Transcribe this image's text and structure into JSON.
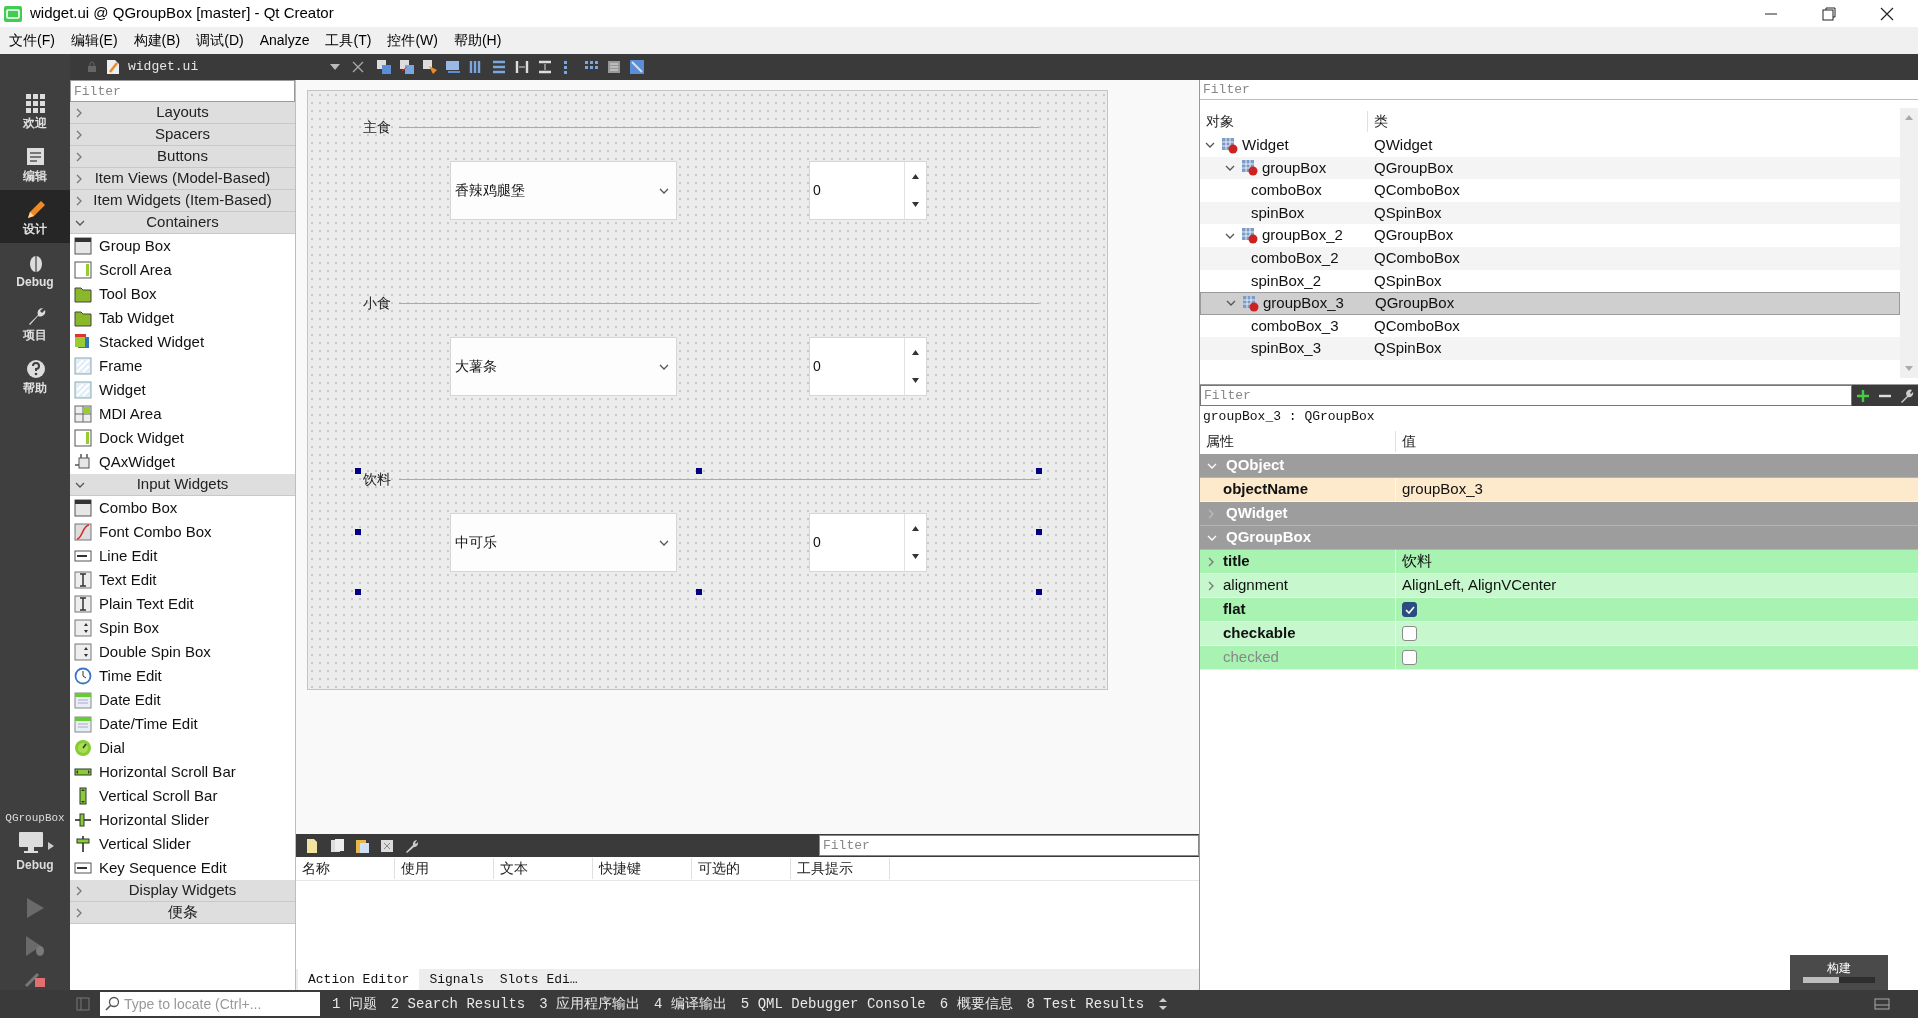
{
  "window": {
    "title": "widget.ui @ QGroupBox [master] - Qt Creator"
  },
  "menu": [
    "文件(F)",
    "编辑(E)",
    "构建(B)",
    "调试(D)",
    "Analyze",
    "工具(T)",
    "控件(W)",
    "帮助(H)"
  ],
  "toolbar": {
    "file": "widget.ui"
  },
  "modes": [
    {
      "label": "欢迎",
      "selected": false
    },
    {
      "label": "编辑",
      "selected": false
    },
    {
      "label": "设计",
      "selected": true
    },
    {
      "label": "Debug",
      "selected": false
    },
    {
      "label": "项目",
      "selected": false
    },
    {
      "label": "帮助",
      "selected": false
    }
  ],
  "kit": {
    "project": "QGroupBox",
    "mode": "Debug"
  },
  "widget_box": {
    "placeholder": "Filter",
    "categories": [
      {
        "label": "Layouts",
        "expanded": false
      },
      {
        "label": "Spacers",
        "expanded": false
      },
      {
        "label": "Buttons",
        "expanded": false
      },
      {
        "label": "Item Views (Model-Based)",
        "expanded": false
      },
      {
        "label": "Item Widgets (Item-Based)",
        "expanded": false
      },
      {
        "label": "Containers",
        "expanded": true,
        "items": [
          "Group Box",
          "Scroll Area",
          "Tool Box",
          "Tab Widget",
          "Stacked Widget",
          "Frame",
          "Widget",
          "MDI Area",
          "Dock Widget",
          "QAxWidget"
        ]
      },
      {
        "label": "Input Widgets",
        "expanded": true,
        "items": [
          "Combo Box",
          "Font Combo Box",
          "Line Edit",
          "Text Edit",
          "Plain Text Edit",
          "Spin Box",
          "Double Spin Box",
          "Time Edit",
          "Date Edit",
          "Date/Time Edit",
          "Dial",
          "Horizontal Scroll Bar",
          "Vertical Scroll Bar",
          "Horizontal Slider",
          "Vertical Slider",
          "Key Sequence Edit"
        ]
      },
      {
        "label": "Display Widgets",
        "expanded": false
      },
      {
        "label": "便条",
        "expanded": false
      }
    ]
  },
  "form": {
    "group_boxes": [
      {
        "title": "主食",
        "combo": "香辣鸡腿堡",
        "spin": "0",
        "selected": false
      },
      {
        "title": "小食",
        "combo": "大薯条",
        "spin": "0",
        "selected": false
      },
      {
        "title": "饮料",
        "combo": "中可乐",
        "spin": "0",
        "selected": true
      }
    ]
  },
  "action_editor": {
    "placeholder": "Filter",
    "columns": [
      "名称",
      "使用",
      "文本",
      "快捷键",
      "可选的",
      "工具提示"
    ],
    "tabs": [
      {
        "label": "Action Editor",
        "selected": true
      },
      {
        "label": "Signals  Slots Edi…",
        "selected": false
      }
    ]
  },
  "object_inspector": {
    "placeholder": "Filter",
    "columns": [
      "对象",
      "类"
    ],
    "tree": [
      {
        "name": "Widget",
        "class": "QWidget",
        "expanded": true,
        "selected": false,
        "children": [
          {
            "name": "groupBox",
            "class": "QGroupBox",
            "expanded": true,
            "selected": false,
            "children": [
              {
                "name": "comboBox",
                "class": "QComboBox",
                "selected": false
              },
              {
                "name": "spinBox",
                "class": "QSpinBox",
                "selected": false
              }
            ]
          },
          {
            "name": "groupBox_2",
            "class": "QGroupBox",
            "expanded": true,
            "selected": false,
            "children": [
              {
                "name": "comboBox_2",
                "class": "QComboBox",
                "selected": false
              },
              {
                "name": "spinBox_2",
                "class": "QSpinBox",
                "selected": false
              }
            ]
          },
          {
            "name": "groupBox_3",
            "class": "QGroupBox",
            "expanded": true,
            "selected": true,
            "children": [
              {
                "name": "comboBox_3",
                "class": "QComboBox",
                "selected": false
              },
              {
                "name": "spinBox_3",
                "class": "QSpinBox",
                "selected": false
              }
            ]
          }
        ]
      }
    ]
  },
  "property_editor": {
    "placeholder": "Filter",
    "object_label": "groupBox_3 : QGroupBox",
    "columns": [
      "属性",
      "值"
    ],
    "groups": [
      {
        "name": "QObject",
        "expanded": true,
        "color": "#fde9cb",
        "properties": [
          {
            "name": "objectName",
            "kind": "text",
            "value": "groupBox_3",
            "changed": true,
            "expandable": false,
            "disabled": false
          }
        ]
      },
      {
        "name": "QWidget",
        "expanded": false
      },
      {
        "name": "QGroupBox",
        "expanded": true,
        "color": "#a8f2b2",
        "properties": [
          {
            "name": "title",
            "kind": "text",
            "value": "饮料",
            "changed": true,
            "expandable": true,
            "disabled": false
          },
          {
            "name": "alignment",
            "kind": "text",
            "value": "AlignLeft, AlignVCenter",
            "changed": false,
            "expandable": true,
            "disabled": false
          },
          {
            "name": "flat",
            "kind": "check",
            "checked": true,
            "changed": true,
            "expandable": false,
            "disabled": false
          },
          {
            "name": "checkable",
            "kind": "check",
            "checked": false,
            "changed": true,
            "expandable": false,
            "disabled": false
          },
          {
            "name": "checked",
            "kind": "check",
            "checked": false,
            "changed": false,
            "expandable": false,
            "disabled": true
          }
        ]
      }
    ]
  },
  "status_bar": {
    "placeholder": "Type to locate (Ctrl+...",
    "panes": [
      "1 问题",
      "2 Search Results",
      "3 应用程序输出",
      "4 编译输出",
      "5 QML Debugger Console",
      "6 概要信息",
      "8 Test Results"
    ]
  },
  "build_button": {
    "label": "构建",
    "level": 0.5
  }
}
